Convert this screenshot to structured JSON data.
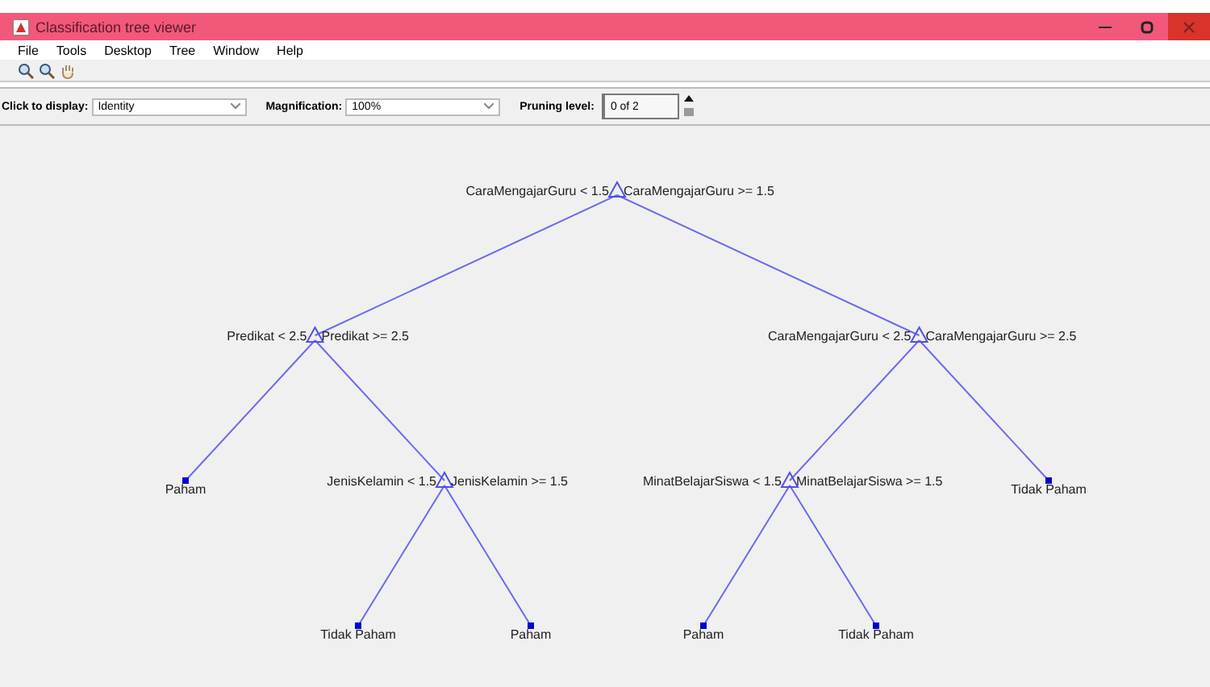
{
  "window": {
    "title": "Classification tree viewer"
  },
  "menu": [
    "File",
    "Tools",
    "Desktop",
    "Tree",
    "Window",
    "Help"
  ],
  "controls": {
    "display_label": "Click to display:",
    "display_value": "Identity",
    "magnification_label": "Magnification:",
    "magnification_value": "100%",
    "pruning_label": "Pruning level:",
    "pruning_value": "0 of 2"
  },
  "tree": {
    "kind": "split",
    "left_label": "CaraMengajarGuru < 1.5",
    "right_label": "CaraMengajarGuru >= 1.5",
    "children": [
      {
        "kind": "split",
        "left_label": "Predikat < 2.5",
        "right_label": "Predikat >= 2.5",
        "children": [
          {
            "kind": "leaf",
            "label": "Paham"
          },
          {
            "kind": "split",
            "left_label": "JenisKelamin < 1.5",
            "right_label": "JenisKelamin >= 1.5",
            "children": [
              {
                "kind": "leaf",
                "label": "Tidak Paham"
              },
              {
                "kind": "leaf",
                "label": "Paham"
              }
            ]
          }
        ]
      },
      {
        "kind": "split",
        "left_label": "CaraMengajarGuru < 2.5",
        "right_label": "CaraMengajarGuru >= 2.5",
        "children": [
          {
            "kind": "split",
            "left_label": "MinatBelajarSiswa < 1.5",
            "right_label": "MinatBelajarSiswa >= 1.5",
            "children": [
              {
                "kind": "leaf",
                "label": "Paham"
              },
              {
                "kind": "leaf",
                "label": "Tidak Paham"
              }
            ]
          },
          {
            "kind": "leaf",
            "label": "Tidak Paham"
          }
        ]
      }
    ]
  }
}
